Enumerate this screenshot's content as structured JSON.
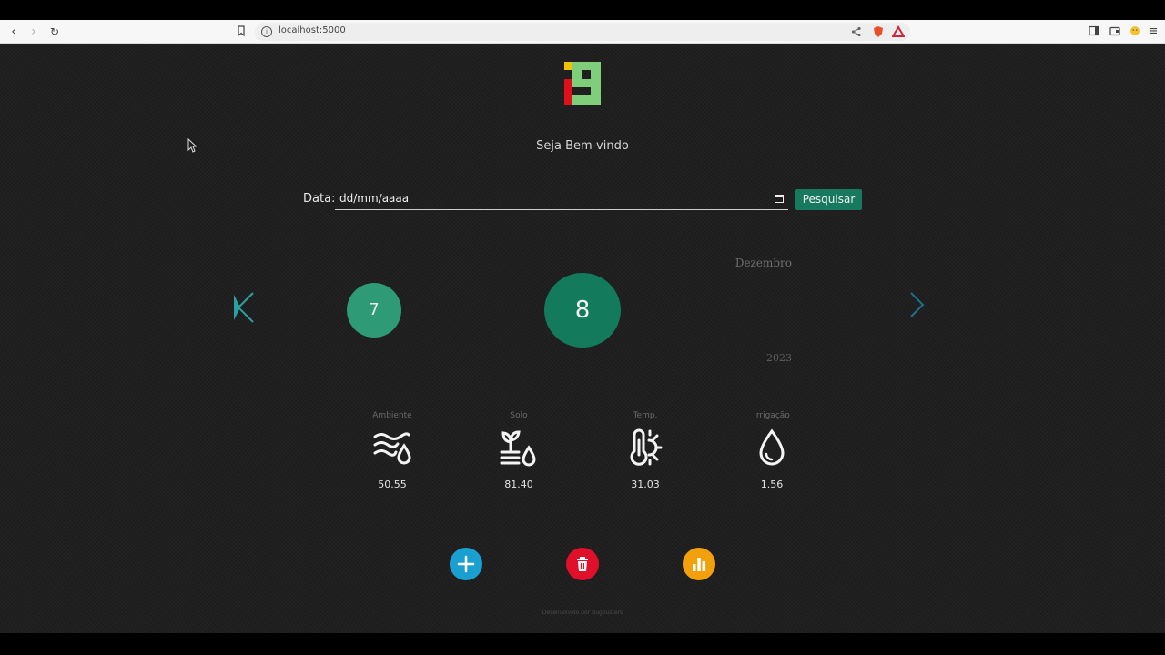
{
  "browser": {
    "url": "localhost:5000"
  },
  "page": {
    "welcome": "Seja Bem-vindo",
    "date_label": "Data:",
    "date_value": "dd/mm/aaaa",
    "search_button": "Pesquisar",
    "month": "Dezembro",
    "year": "2023",
    "day_previous": "7",
    "day_current": "8",
    "footer": "Desenvolvido por Bugbusters"
  },
  "sensors": [
    {
      "label": "Ambiente",
      "value": "50.55",
      "icon": "humidity-wind-icon"
    },
    {
      "label": "Solo",
      "value": "81.40",
      "icon": "soil-sprout-icon"
    },
    {
      "label": "Temp.",
      "value": "31.03",
      "icon": "thermometer-sun-icon"
    },
    {
      "label": "Irrigação",
      "value": "1.56",
      "icon": "water-drop-icon"
    }
  ],
  "actions": [
    {
      "icon": "plus-icon",
      "color": "#1a9fd1"
    },
    {
      "icon": "trash-icon",
      "color": "#e0102a"
    },
    {
      "icon": "bar-chart-icon",
      "color": "#f2a10d"
    }
  ],
  "colors": {
    "accent": "#17795d",
    "day_previous": "#2e9a76",
    "day_current": "#137a5b",
    "logo_yellow": "#f2c200",
    "logo_red": "#e0101a",
    "logo_green": "#7fcf7a"
  }
}
